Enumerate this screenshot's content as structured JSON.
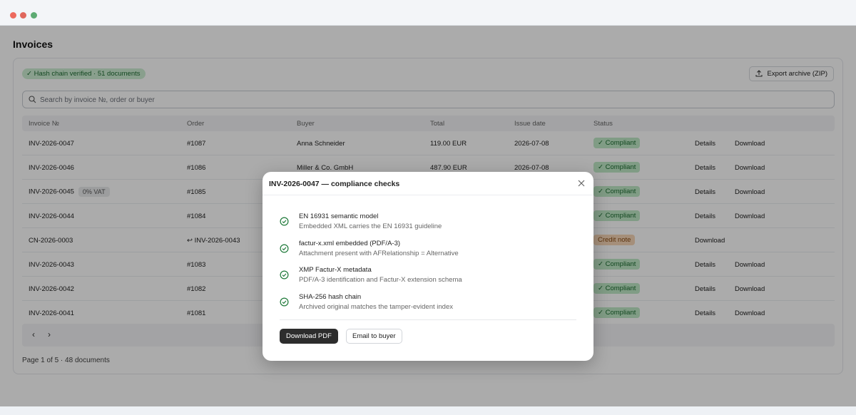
{
  "page_title": "Invoices",
  "verified_badge": "✓ Hash chain verified · 51 documents",
  "export_button": "Export archive (ZIP)",
  "search_placeholder": "Search by invoice №, order or buyer",
  "columns": [
    "Invoice №",
    "Order",
    "Buyer",
    "Total",
    "Issue date",
    "Status"
  ],
  "rows": [
    {
      "invoice": "INV-2026-0047",
      "order": "#1087",
      "buyer": "Anna Schneider",
      "total": "119.00 EUR",
      "date": "2026-07-08",
      "status": "✓ Compliant",
      "details": "Details",
      "download": "Download"
    },
    {
      "invoice": "INV-2026-0046",
      "order": "#1086",
      "buyer": "Miller & Co. GmbH",
      "total": "487.90 EUR",
      "date": "2026-07-08",
      "status": "✓ Compliant",
      "details": "Details",
      "download": "Download"
    },
    {
      "invoice": "INV-2026-0045",
      "tag": "0% VAT",
      "order": "#1085",
      "status": "✓ Compliant",
      "details": "Details",
      "download": "Download"
    },
    {
      "invoice": "INV-2026-0044",
      "order": "#1084",
      "status": "✓ Compliant",
      "details": "Details",
      "download": "Download"
    },
    {
      "invoice": "CN-2026-0003",
      "order": "↩ INV-2026-0043",
      "status": "Credit note",
      "download": "Download"
    },
    {
      "invoice": "INV-2026-0043",
      "order": "#1083",
      "status": "✓ Compliant",
      "details": "Details",
      "download": "Download"
    },
    {
      "invoice": "INV-2026-0042",
      "order": "#1082",
      "status": "✓ Compliant",
      "details": "Details",
      "download": "Download"
    },
    {
      "invoice": "INV-2026-0041",
      "order": "#1081",
      "status": "✓ Compliant",
      "details": "Details",
      "download": "Download"
    }
  ],
  "pager": {
    "prev": "‹",
    "next": "›",
    "info": "Page 1 of 5 · 48 documents"
  },
  "modal": {
    "title": "INV-2026-0047 — compliance checks",
    "checks": [
      {
        "title": "EN 16931 semantic model",
        "desc": "Embedded XML carries the EN 16931 guideline"
      },
      {
        "title": "factur-x.xml embedded (PDF/A-3)",
        "desc": "Attachment present with AFRelationship = Alternative"
      },
      {
        "title": "XMP Factur-X metadata",
        "desc": "PDF/A-3 identification and Factur-X extension schema"
      },
      {
        "title": "SHA-256 hash chain",
        "desc": "Archived original matches the tamper-evident index"
      }
    ],
    "primary_button": "Download PDF",
    "secondary_button": "Email to buyer"
  },
  "colors": {
    "compliant_bg": "#bfe9c6",
    "credit_bg": "#f6d6b7",
    "primary_button": "#2d2d2d"
  },
  "icons": [
    "upload-icon",
    "search-icon",
    "check-circle-icon",
    "close-icon"
  ]
}
